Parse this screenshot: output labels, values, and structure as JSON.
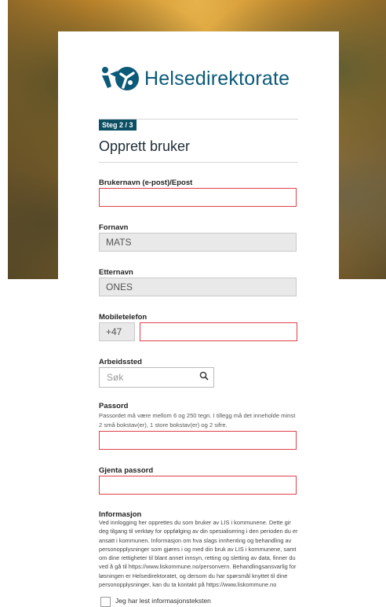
{
  "brand": {
    "name": "Helsedirektorate",
    "logo_icon": "helsedirektoratet-logo-icon",
    "color": "#0b5a78"
  },
  "step_badge": "Steg 2 / 3",
  "page_title": "Opprett bruker",
  "fields": {
    "username": {
      "label": "Brukernavn (e-post)/Epost",
      "value": ""
    },
    "first_name": {
      "label": "Fornavn",
      "value": "MATS"
    },
    "last_name": {
      "label": "Etternavn",
      "value": "ONES"
    },
    "mobile": {
      "label": "Mobiletelefon",
      "prefix": "+47",
      "value": ""
    },
    "workplace": {
      "label": "Arbeidssted",
      "placeholder": "Søk",
      "icon": "search-icon"
    },
    "password": {
      "label": "Passord",
      "hint": "Passordet må være mellom 6 og 250 tegn. I tillegg må det inneholde minst 2 små bokstav(er), 1 store bokstav(er) og 2 sifre.",
      "value": ""
    },
    "password_repeat": {
      "label": "Gjenta passord",
      "value": ""
    }
  },
  "information": {
    "heading": "Informasjon",
    "text": "Ved innlogging her opprettes du som bruker av LIS i kommunene. Dette gir deg tilgang til verktøy for oppfølging av din spesialisering i den perioden du er ansatt i kommunen.  Informasjon om hva slags innhenting og behandling av personopplysninger som gjøres i og med din bruk av LIS i kommunene, samt om dine rettigheter til blant annet innsyn, retting og sletting av data, finner du ved å gå til https://www.liskommune.no/personvern.  Behandlingsansvarlig for løsningen er Helsedirektoratet, og dersom du har spørsmål knyttet til dine personopplysninger, kan du ta kontakt på https://www.liskommune.no",
    "checkbox_label": "Jeg har lest informasjonsteksten"
  },
  "colors": {
    "error_border": "#e0404b",
    "step_badge_bg": "#0b4f63",
    "disabled_bg": "#e9e9e9"
  }
}
